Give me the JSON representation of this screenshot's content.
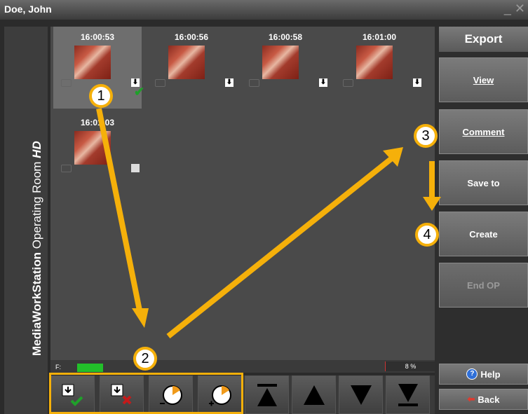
{
  "window": {
    "title": "Doe, John",
    "controls": "_ ✕"
  },
  "brand": {
    "part1": "MediaWorkStation",
    "part2": " Operating Room ",
    "part3": "HD"
  },
  "thumbnails": [
    {
      "time": "16:00:53",
      "selected": true
    },
    {
      "time": "16:00:56"
    },
    {
      "time": "16:00:58"
    },
    {
      "time": "16:01:00"
    },
    {
      "time": "16:01:03"
    }
  ],
  "status": {
    "label": "F:",
    "percent": "8 %"
  },
  "side": {
    "export": "Export",
    "view": "View",
    "comment": "Comment",
    "save_to": "Save to",
    "create": "Create",
    "end_op": "End OP",
    "help": "Help",
    "back": "Back"
  },
  "steps": [
    "1",
    "2",
    "3",
    "4"
  ],
  "colors": {
    "accent": "#f5b00a",
    "check": "#1fa02a"
  }
}
